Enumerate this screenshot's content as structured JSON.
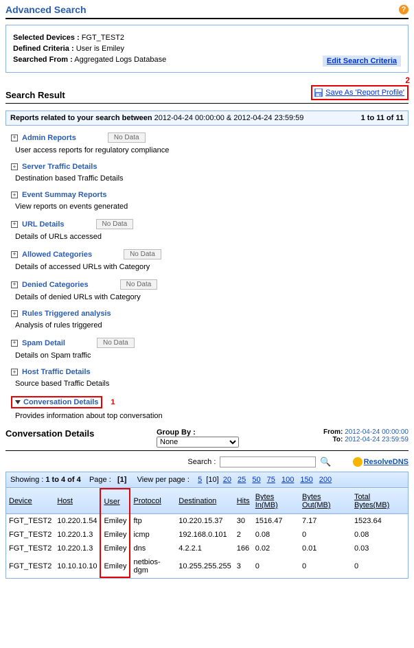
{
  "page_title": "Advanced Search",
  "criteria": {
    "devices_label": "Selected Devices :",
    "devices_value": "FGT_TEST2",
    "defined_label": "Defined Criteria :",
    "defined_value": "User is Emiley",
    "from_label": "Searched From :",
    "from_value": "Aggregated Logs Database",
    "edit_link": "Edit Search Criteria"
  },
  "result_header": "Search  Result",
  "save_as": "Save  As  'Report  Profile'",
  "callout": {
    "one": "1",
    "two": "2"
  },
  "summary": {
    "prefix": "Reports related to your search between ",
    "range": "2012-04-24 00:00:00 & 2012-04-24 23:59:59",
    "count": "1 to 11 of 11"
  },
  "nodata": "No Data",
  "reports": [
    {
      "title": "Admin Reports",
      "desc": "User access reports for regulatory compliance",
      "nodata": true
    },
    {
      "title": "Server Traffic Details",
      "desc": "Destination based Traffic Details",
      "nodata": false
    },
    {
      "title": "Event Summay Reports",
      "desc": "View reports on events generated",
      "nodata": false
    },
    {
      "title": "URL Details",
      "desc": "Details of URLs accessed",
      "nodata": true
    },
    {
      "title": "Allowed Categories",
      "desc": "Details of accessed URLs with Category",
      "nodata": true
    },
    {
      "title": "Denied Categories",
      "desc": "Details of denied URLs with Category",
      "nodata": true
    },
    {
      "title": "Rules Triggered analysis",
      "desc": "Analysis of rules triggered",
      "nodata": false
    },
    {
      "title": "Spam Detail",
      "desc": "Details on Spam traffic",
      "nodata": true
    },
    {
      "title": "Host Traffic Details",
      "desc": "Source based Traffic Details",
      "nodata": false
    }
  ],
  "conv": {
    "title": "Conversation Details",
    "desc": "Provides information about top conversation"
  },
  "detail": {
    "title": "Conversation  Details",
    "groupby_label": "Group  By  :",
    "groupby_value": "None",
    "from_label": "From:",
    "from_value": "2012-04-24  00:00:00",
    "to_label": "To:",
    "to_value": "2012-04-24  23:59:59",
    "search_label": "Search :",
    "resolve": "ResolveDNS"
  },
  "pager": {
    "showing_prefix": "Showing : ",
    "showing_bold": "1 to 4 of 4",
    "page_label": "Page :",
    "page_current": "[1]",
    "vpp_label": "View per page :",
    "sizes": [
      "5",
      "[10]",
      "20",
      "25",
      "50",
      "75",
      "100",
      "150",
      "200"
    ]
  },
  "columns": [
    "Device",
    "Host",
    "User",
    "Protocol",
    "Destination",
    "Hits",
    "Bytes In(MB)",
    "Bytes Out(MB)",
    "Total Bytes(MB)"
  ],
  "rows": [
    [
      "FGT_TEST2",
      "10.220.1.54",
      "Emiley",
      "ftp",
      "10.220.15.37",
      "30",
      "1516.47",
      "7.17",
      "1523.64"
    ],
    [
      "FGT_TEST2",
      "10.220.1.3",
      "Emiley",
      "icmp",
      "192.168.0.101",
      "2",
      "0.08",
      "0",
      "0.08"
    ],
    [
      "FGT_TEST2",
      "10.220.1.3",
      "Emiley",
      "dns",
      "4.2.2.1",
      "166",
      "0.02",
      "0.01",
      "0.03"
    ],
    [
      "FGT_TEST2",
      "10.10.10.10",
      "Emiley",
      "netbios-dgm",
      "10.255.255.255",
      "3",
      "0",
      "0",
      "0"
    ]
  ]
}
